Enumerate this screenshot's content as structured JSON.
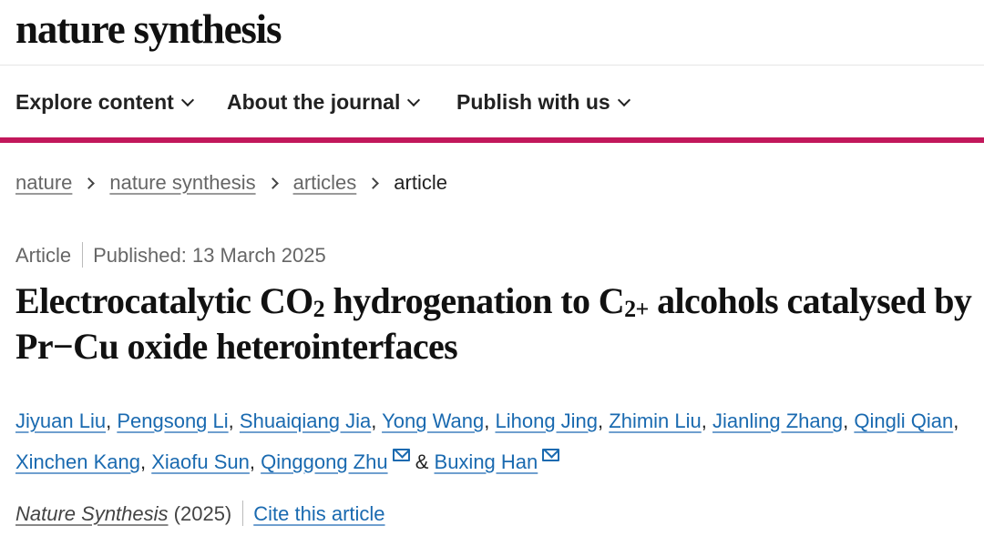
{
  "header": {
    "brand": "nature synthesis"
  },
  "nav": {
    "items": [
      {
        "label": "Explore content"
      },
      {
        "label": "About the journal"
      },
      {
        "label": "Publish with us"
      }
    ],
    "accent_color": "#c2185b"
  },
  "breadcrumb": {
    "items": [
      "nature",
      "nature synthesis",
      "articles"
    ],
    "current": "article"
  },
  "article": {
    "type": "Article",
    "published": "Published: 13 March 2025",
    "title": {
      "part1": "Electrocatalytic CO",
      "sub1": "2",
      "part2": " hydrogenation to C",
      "sub2": "2+",
      "part3": " alcohols catalysed by Pr−Cu oxide heterointerfaces"
    },
    "authors": [
      "Jiyuan Liu",
      "Pengsong Li",
      "Shuaiqiang Jia",
      "Yong Wang",
      "Lihong Jing",
      "Zhimin Liu",
      "Jianling Zhang",
      "Qingli Qian",
      "Xinchen Kang",
      "Xiaofu Sun",
      "Qinggong Zhu",
      "Buxing Han"
    ],
    "author_separator": ",",
    "author_conjunction": "&",
    "journal": "Nature Synthesis",
    "year": "(2025)",
    "cite_label": "Cite this article"
  },
  "colors": {
    "link": "#1a6ab0",
    "muted": "#666666",
    "text": "#222222"
  },
  "icons": [
    "chevron-down-icon",
    "chevron-right-icon",
    "mail-icon"
  ]
}
